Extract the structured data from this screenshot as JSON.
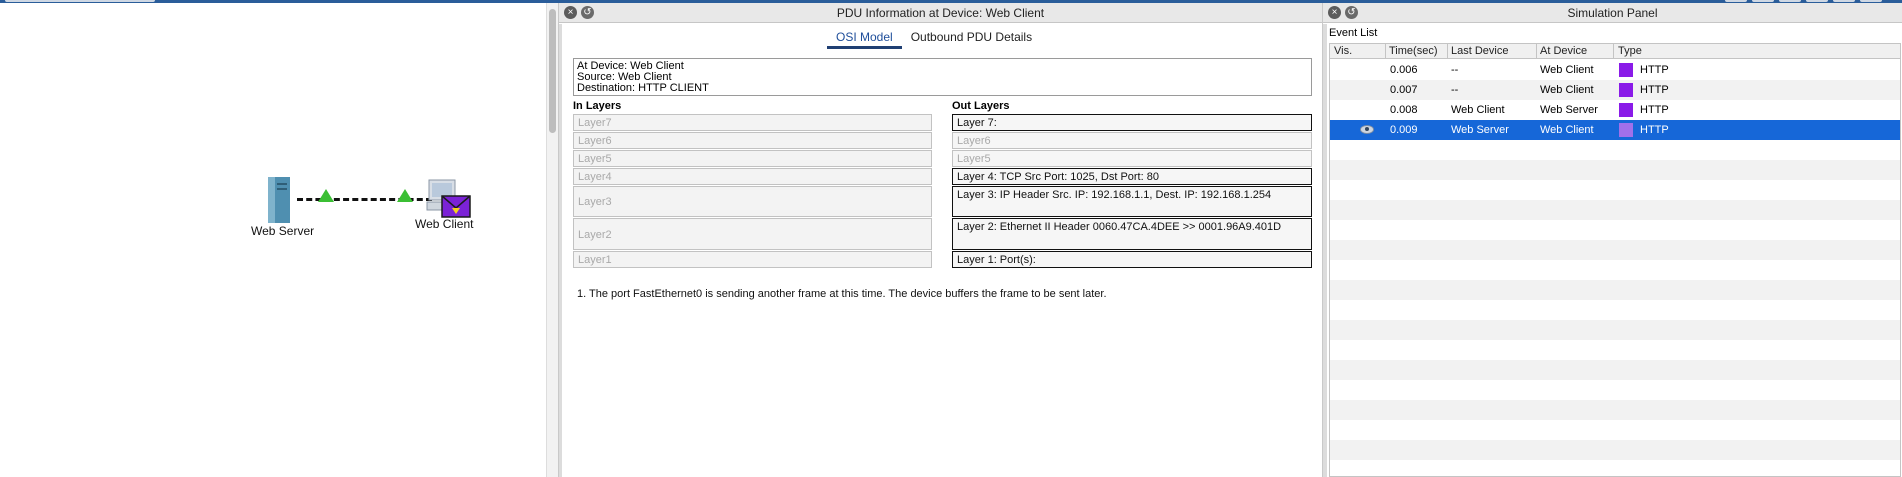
{
  "workspace": {
    "devices": [
      {
        "name": "Web Server"
      },
      {
        "name": "Web Client"
      }
    ]
  },
  "pdu": {
    "title": "PDU Information at Device: Web Client",
    "tabs": [
      {
        "label": "OSI Model",
        "active": true
      },
      {
        "label": "Outbound PDU Details",
        "active": false
      }
    ],
    "info": {
      "at_device": "At Device: Web Client",
      "source": "Source: Web Client",
      "destination": "Destination: HTTP CLIENT"
    },
    "in_layers_title": "In Layers",
    "out_layers_title": "Out Layers",
    "in_layers": [
      "Layer7",
      "Layer6",
      "Layer5",
      "Layer4",
      "Layer3",
      "Layer2",
      "Layer1"
    ],
    "out_layers": [
      {
        "text": "Layer 7:",
        "active": true
      },
      {
        "text": "Layer6",
        "active": false
      },
      {
        "text": "Layer5",
        "active": false
      },
      {
        "text": "Layer 4: TCP Src Port: 1025, Dst Port: 80",
        "active": true
      },
      {
        "text": "Layer 3: IP Header Src. IP: 192.168.1.1, Dest. IP: 192.168.1.254",
        "active": true
      },
      {
        "text": "Layer 2: Ethernet II Header 0060.47CA.4DEE >> 0001.96A9.401D",
        "active": true
      },
      {
        "text": "Layer 1: Port(s):",
        "active": true
      }
    ],
    "note": "1. The port FastEthernet0 is sending another frame at this time. The device buffers the frame to be sent later."
  },
  "sim": {
    "title": "Simulation Panel",
    "event_list_label": "Event List",
    "columns": [
      "Vis.",
      "Time(sec)",
      "Last Device",
      "At Device",
      "Type"
    ],
    "events": [
      {
        "time": "0.006",
        "last": "--",
        "at": "Web Client",
        "type": "HTTP",
        "selected": false
      },
      {
        "time": "0.007",
        "last": "--",
        "at": "Web Client",
        "type": "HTTP",
        "selected": false
      },
      {
        "time": "0.008",
        "last": "Web Client",
        "at": "Web Server",
        "type": "HTTP",
        "selected": false
      },
      {
        "time": "0.009",
        "last": "Web Server",
        "at": "Web Client",
        "type": "HTTP",
        "selected": true
      }
    ],
    "type_color": "#8a1be8",
    "selected_color": "#1667d8"
  }
}
